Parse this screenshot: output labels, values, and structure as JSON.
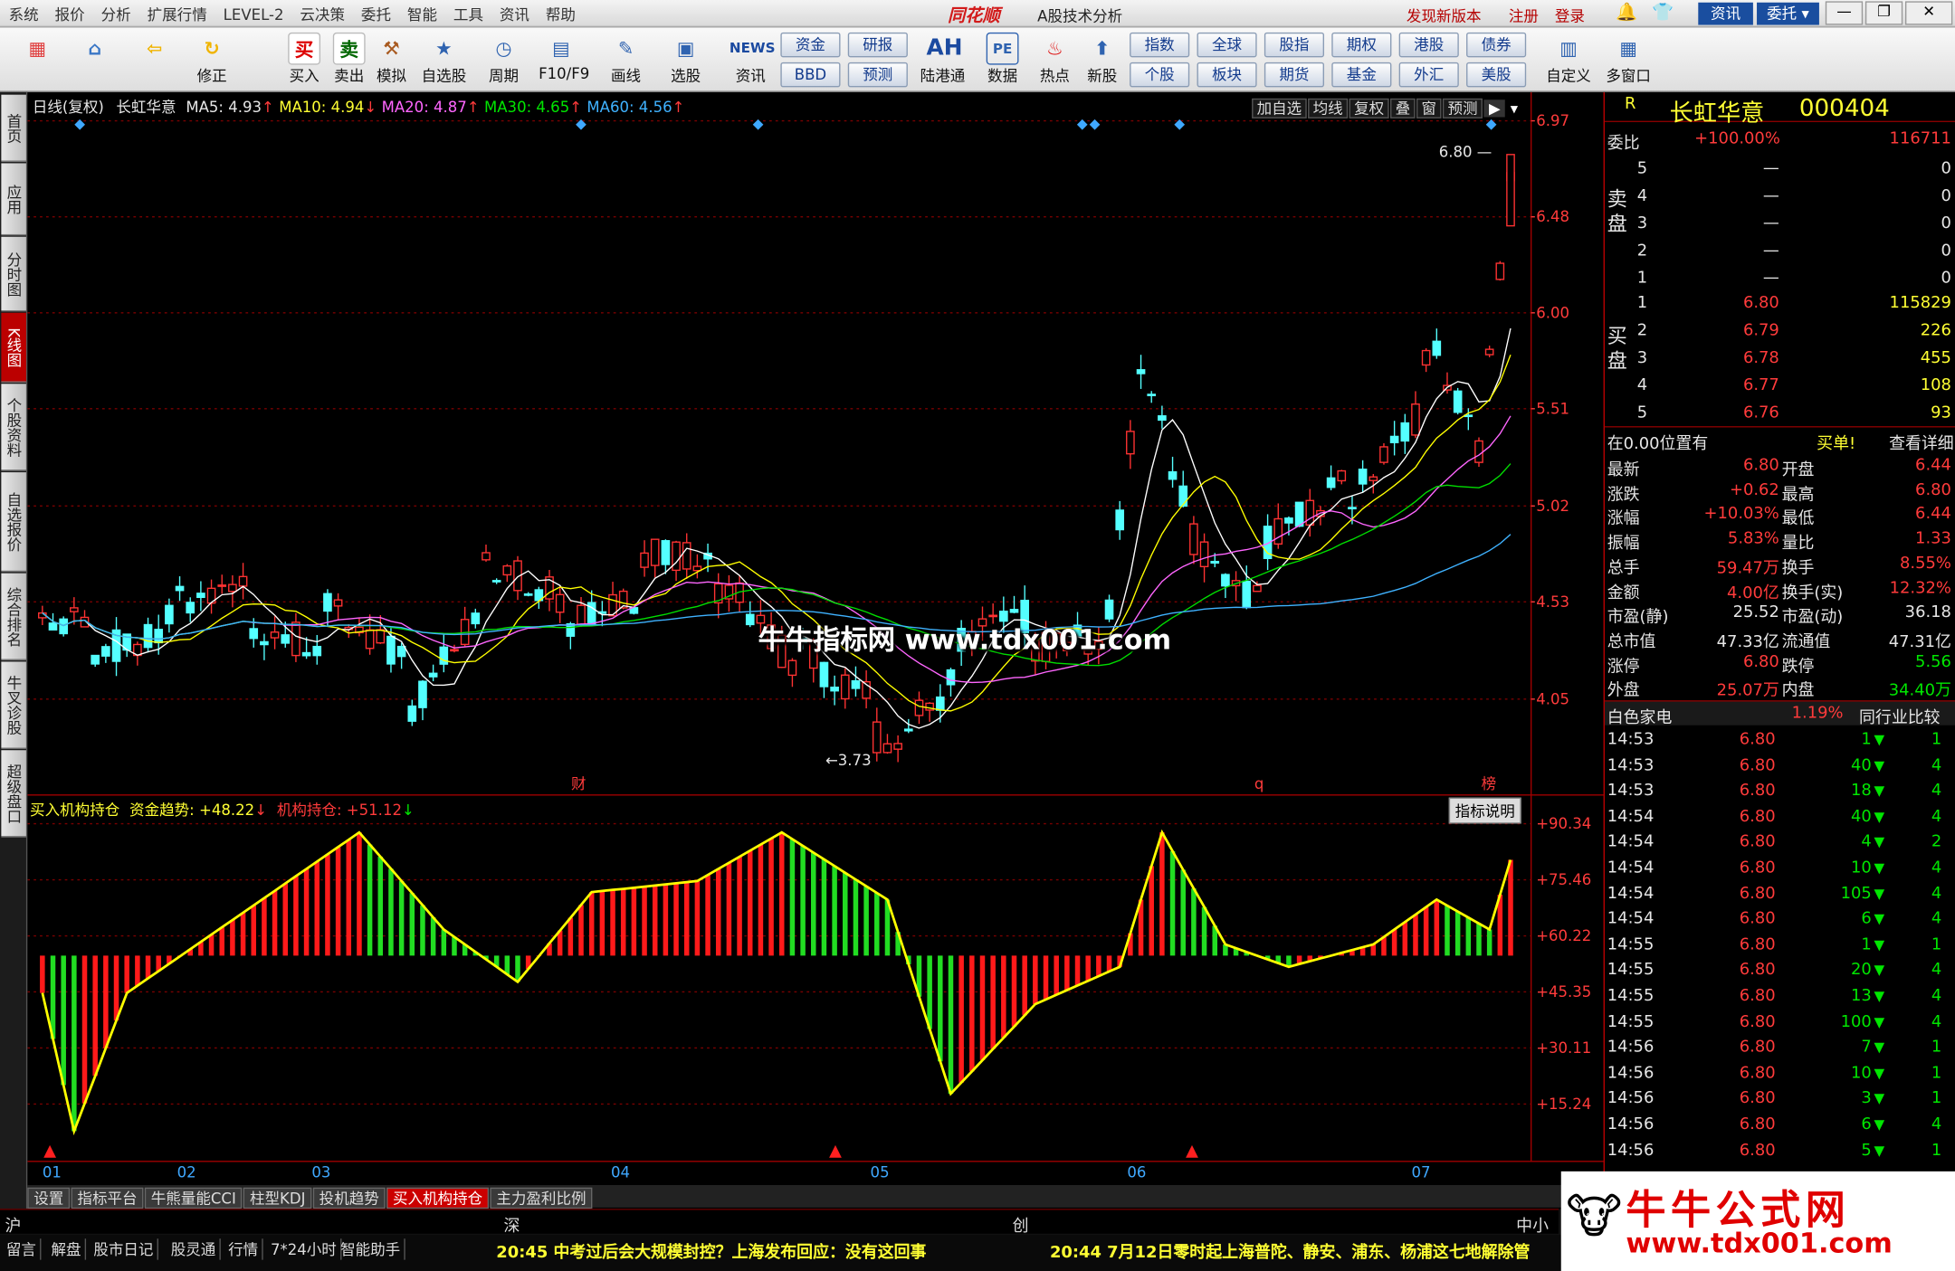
{
  "menu": [
    "系统",
    "报价",
    "分析",
    "扩展行情",
    "LEVEL-2",
    "云决策",
    "委托",
    "智能",
    "工具",
    "资讯",
    "帮助"
  ],
  "brand": "同花顺",
  "app_title": "A股技术分析",
  "top_links": [
    "发现新版本",
    "注册",
    "登录"
  ],
  "top_buttons": [
    "资讯",
    "委托"
  ],
  "toolbar": [
    {
      "label": "",
      "icon": "grid-icon"
    },
    {
      "label": "",
      "icon": "home-icon"
    },
    {
      "label": "",
      "icon": "back-icon"
    },
    {
      "label": "修正",
      "icon": "refresh-icon"
    },
    {
      "label": "买入",
      "icon": "buy-icon",
      "glyph": "买"
    },
    {
      "label": "卖出",
      "icon": "sell-icon",
      "glyph": "卖"
    },
    {
      "label": "模拟",
      "icon": "hammer-icon"
    },
    {
      "label": "自选股",
      "icon": "star-icon"
    },
    {
      "label": "周期",
      "icon": "clock-icon"
    },
    {
      "label": "F10/F9",
      "icon": "f10-icon"
    },
    {
      "label": "画线",
      "icon": "pen-icon"
    },
    {
      "label": "选股",
      "icon": "screen-icon"
    },
    {
      "label": "资讯",
      "icon": "news-icon",
      "glyph": "NEWS"
    },
    {
      "label": "陆港通",
      "icon": "ah-icon",
      "glyph": "AH"
    },
    {
      "label": "数据",
      "icon": "pe-icon",
      "glyph": "PE"
    },
    {
      "label": "热点",
      "icon": "hot-icon"
    },
    {
      "label": "新股",
      "icon": "ipo-icon"
    },
    {
      "label": "自定义",
      "icon": "custom-icon"
    },
    {
      "label": "多窗口",
      "icon": "windows-icon"
    }
  ],
  "toolbar_buttons": [
    [
      "资金",
      "BBD"
    ],
    [
      "研报",
      "预测"
    ],
    [
      "指数",
      "个股"
    ],
    [
      "全球",
      "板块"
    ],
    [
      "股指",
      "期货"
    ],
    [
      "期权",
      "基金"
    ],
    [
      "港股",
      "外汇"
    ],
    [
      "债券",
      "美股"
    ]
  ],
  "sidebar": [
    "首页",
    "应用",
    "分时图",
    "K线图",
    "个股资料",
    "自选报价",
    "综合排名",
    "牛叉诊股",
    "超级盘口"
  ],
  "chart_header": {
    "period": "日线(复权)",
    "name": "长虹华意",
    "ma5": "MA5: 4.93",
    "ma10": "MA10: 4.94",
    "ma20": "MA20: 4.87",
    "ma30": "MA30: 4.65",
    "ma60": "MA60: 4.56"
  },
  "chart_buttons": [
    "加自选",
    "均线",
    "复权",
    "叠",
    "窗",
    "预测"
  ],
  "marks": {
    "high": "6.80",
    "low": "3.73",
    "cai": "财",
    "q": "q",
    "bang": "榜"
  },
  "indicator_header": {
    "name": "买入机构持仓",
    "trend": "资金趋势: +48.22",
    "inst": "机构持仓: +51.12",
    "explain": "指标说明"
  },
  "watermark": "牛牛指标网 www.tdx001.com",
  "x_labels": [
    "01",
    "02",
    "03",
    "04",
    "05",
    "06",
    "07"
  ],
  "bottom_tabs": [
    "设置",
    "指标平台",
    "牛熊量能CCI",
    "柱型KDJ",
    "投机趋势",
    "买入机构持仓",
    "主力盈利比例"
  ],
  "stock": {
    "name": "长虹华意",
    "code": "000404",
    "r": "R"
  },
  "weibi": {
    "label": "委比",
    "pct": "+100.00%",
    "val": "116711"
  },
  "asks": [
    [
      "5",
      "—",
      "0"
    ],
    [
      "4",
      "—",
      "0"
    ],
    [
      "3",
      "—",
      "0"
    ],
    [
      "2",
      "—",
      "0"
    ],
    [
      "1",
      "—",
      "0"
    ]
  ],
  "bids": [
    [
      "1",
      "6.80",
      "115829"
    ],
    [
      "2",
      "6.79",
      "226"
    ],
    [
      "3",
      "6.78",
      "455"
    ],
    [
      "4",
      "6.77",
      "108"
    ],
    [
      "5",
      "6.76",
      "93"
    ]
  ],
  "ask_label": "卖盘",
  "bid_label": "买盘",
  "pos_line": {
    "left": "在0.00位置有",
    "mid": "买单!",
    "right": "查看详细"
  },
  "quote": [
    [
      "最新",
      "6.80",
      "开盘",
      "6.44"
    ],
    [
      "涨跌",
      "+0.62",
      "最高",
      "6.80"
    ],
    [
      "涨幅",
      "+10.03%",
      "最低",
      "6.44"
    ],
    [
      "振幅",
      "5.83%",
      "量比",
      "1.33"
    ],
    [
      "总手",
      "59.47万",
      "换手",
      "8.55%"
    ],
    [
      "金额",
      "4.00亿",
      "换手(实)",
      "12.32%"
    ],
    [
      "市盈(静)",
      "25.52",
      "市盈(动)",
      "36.18"
    ],
    [
      "总市值",
      "47.33亿",
      "流通值",
      "47.31亿"
    ],
    [
      "涨停",
      "6.80",
      "跌停",
      "5.56"
    ],
    [
      "外盘",
      "25.07万",
      "内盘",
      "34.40万"
    ]
  ],
  "sector": {
    "name": "白色家电",
    "pct": "1.19%",
    "btn": "同行业比较"
  },
  "ticks": [
    [
      "14:53",
      "6.80",
      "1",
      "1"
    ],
    [
      "14:53",
      "6.80",
      "40",
      "4"
    ],
    [
      "14:53",
      "6.80",
      "18",
      "4"
    ],
    [
      "14:54",
      "6.80",
      "40",
      "4"
    ],
    [
      "14:54",
      "6.80",
      "4",
      "2"
    ],
    [
      "14:54",
      "6.80",
      "10",
      "4"
    ],
    [
      "14:54",
      "6.80",
      "105",
      "4"
    ],
    [
      "14:54",
      "6.80",
      "6",
      "4"
    ],
    [
      "14:55",
      "6.80",
      "1",
      "1"
    ],
    [
      "14:55",
      "6.80",
      "20",
      "4"
    ],
    [
      "14:55",
      "6.80",
      "13",
      "4"
    ],
    [
      "14:55",
      "6.80",
      "100",
      "4"
    ],
    [
      "14:56",
      "6.80",
      "7",
      "1"
    ],
    [
      "14:56",
      "6.80",
      "10",
      "1"
    ],
    [
      "14:56",
      "6.80",
      "3",
      "1"
    ],
    [
      "14:56",
      "6.80",
      "6",
      "4"
    ],
    [
      "14:56",
      "6.80",
      "5",
      "1"
    ]
  ],
  "market_bar": [
    "沪",
    "深",
    "创",
    "中小"
  ],
  "status_items": [
    "留言",
    "解盘",
    "股市日记",
    "股灵通",
    "行情",
    "7*24小时",
    "智能助手"
  ],
  "news": [
    "20:45 中考过后会大规模封控？上海发布回应：没有这回事",
    "20:44 7月12日零时起上海普陀、静安、浦东、杨浦这七地解除管"
  ],
  "logo_text": {
    "top": "牛牛公式网",
    "url": "www.tdx001.com"
  },
  "price_axis": [
    "6.97",
    "6.48",
    "6.00",
    "5.51",
    "5.02",
    "4.53",
    "4.05"
  ],
  "ind_axis": [
    "90.34",
    "75.46",
    "60.22",
    "45.35",
    "30.11",
    "15.24"
  ],
  "colors": {
    "up": "#ff3232",
    "down": "#54ffff",
    "ma5": "#ffffff",
    "ma10": "#ffff00",
    "ma20": "#ff66ff",
    "ma30": "#00dd00",
    "ma60": "#3fb2ff"
  }
}
